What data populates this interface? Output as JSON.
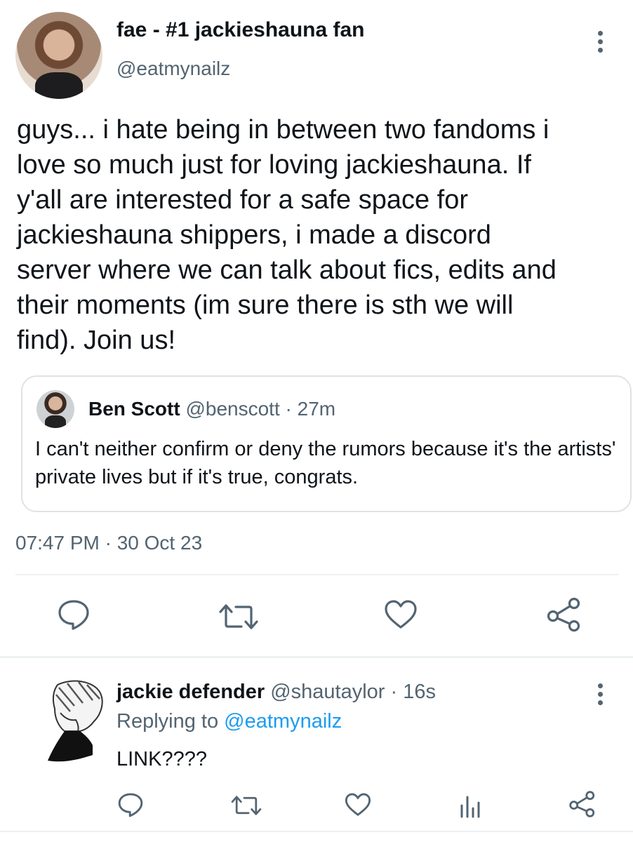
{
  "tweet": {
    "author_name": "fae - #1 jackieshauna fan",
    "author_handle": "@eatmynailz",
    "text": "guys... i hate being in between two fandoms i\nlove so much just for loving jackieshauna. If\ny'all are interested for a safe space for\njackieshauna shippers, i made a discord\nserver where we can talk about fics, edits and\ntheir moments (im sure there is sth we will\nfind). Join us!",
    "timestamp": "07:47 PM · 30 Oct 23"
  },
  "quote": {
    "author_name": "Ben Scott",
    "author_handle": "@benscott",
    "time": " · 27m",
    "text": "I can't neither confirm or deny the rumors because it's the artists' private lives but if it's true, congrats."
  },
  "reply": {
    "author_name": "jackie defender",
    "author_handle": "@shautaylor",
    "time": " · 16s",
    "replying_prefix": "Replying to ",
    "replying_to": "@eatmynailz",
    "text": "LINK????"
  },
  "icons": {
    "main_actions": [
      "reply-icon",
      "retweet-icon",
      "like-icon",
      "share-icon"
    ],
    "reply_actions": [
      "reply-icon",
      "retweet-icon",
      "like-icon",
      "analytics-icon",
      "share-icon"
    ]
  },
  "colors": {
    "text": "#0f1419",
    "secondary": "#536471",
    "accent": "#1d9bf0",
    "border": "#dfe3e6"
  }
}
